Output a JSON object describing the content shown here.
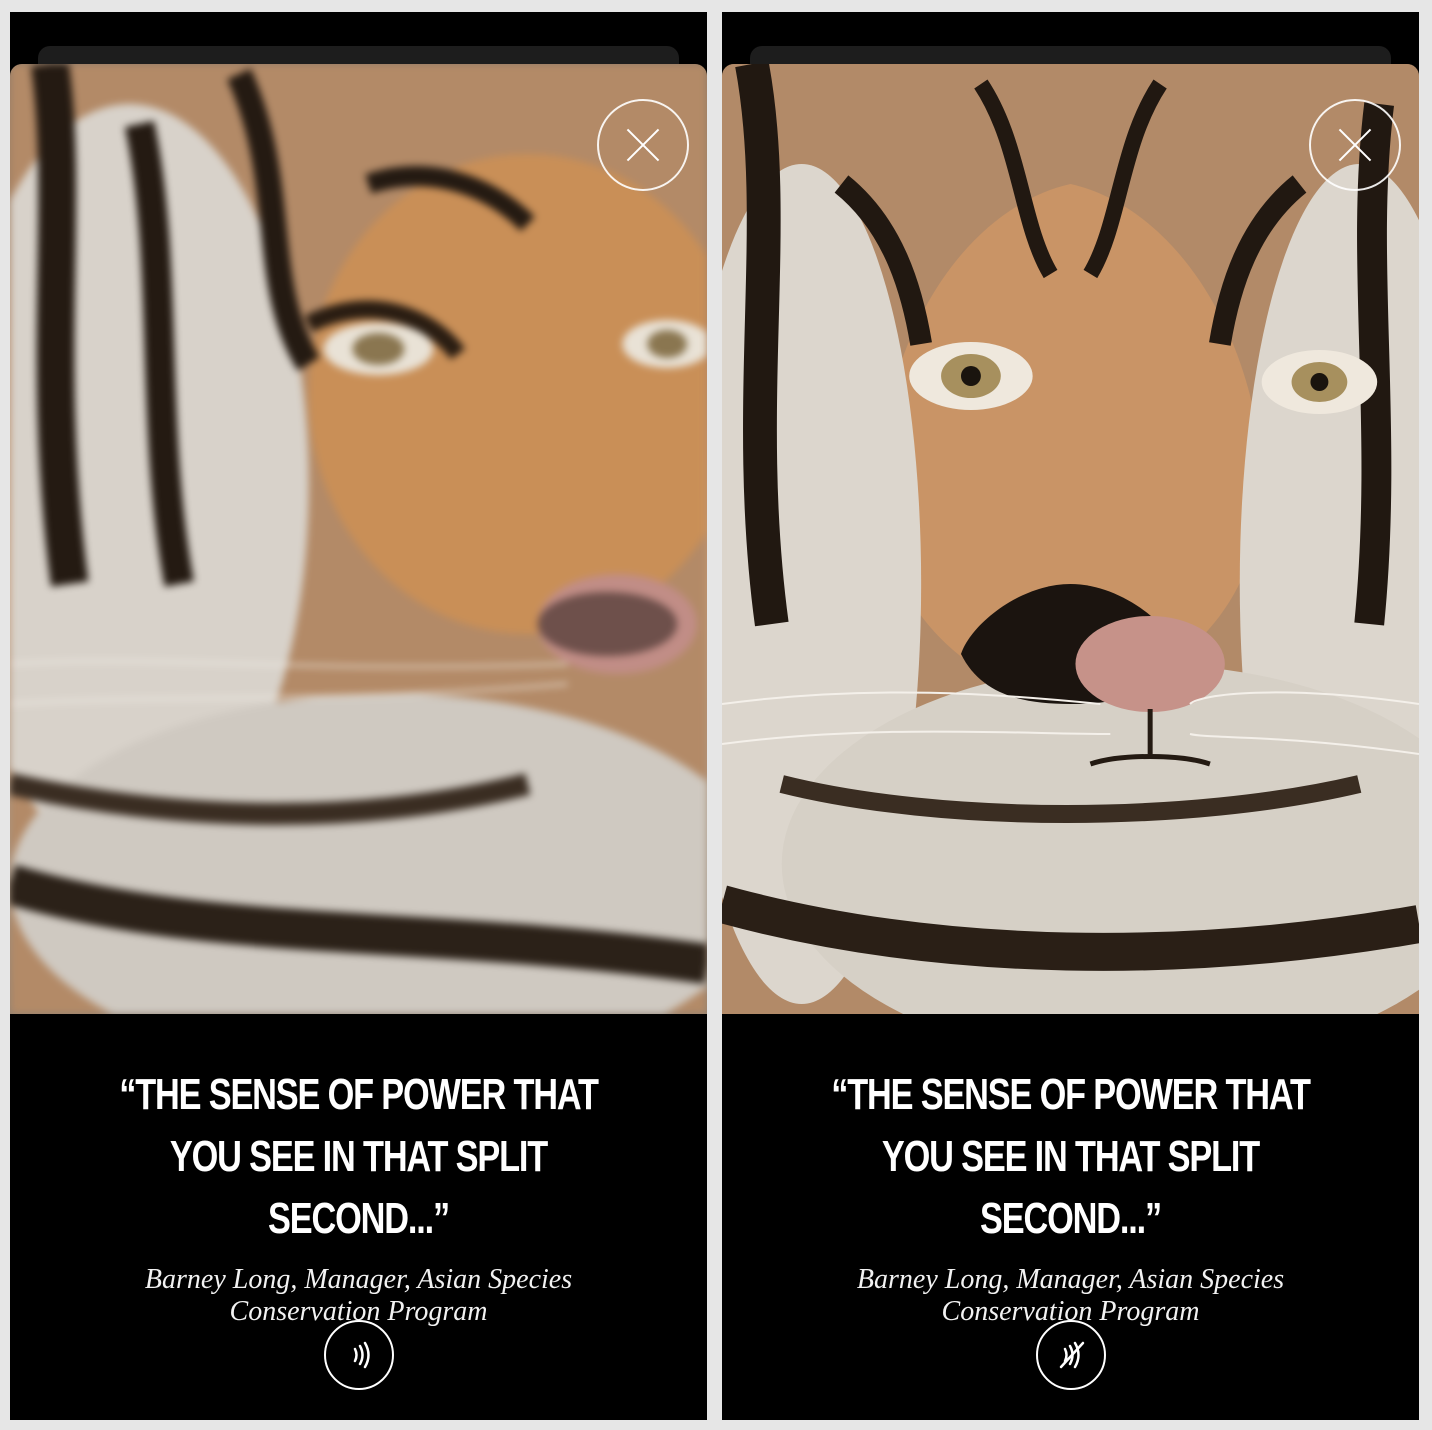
{
  "screens": [
    {
      "state": "blurred",
      "close_icon": "close-icon",
      "quote": "“THE SENSE OF POWER THAT YOU SEE IN THAT SPLIT SECOND...”",
      "attribution": "Barney Long, Manager, Asian Species Conservation Program",
      "audio_icon": "sound-on-icon"
    },
    {
      "state": "sharp",
      "close_icon": "close-icon",
      "quote": "“THE SENSE OF POWER THAT YOU SEE IN THAT SPLIT SECOND...”",
      "attribution": "Barney Long, Manager, Asian Species Conservation Program",
      "audio_icon": "sound-muted-icon"
    }
  ],
  "colors": {
    "caption_bg": "#000000",
    "text": "#ffffff"
  }
}
